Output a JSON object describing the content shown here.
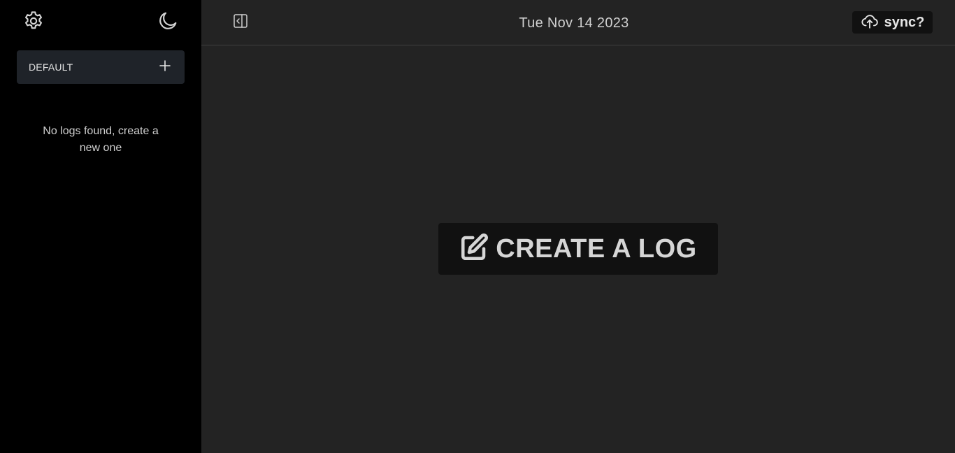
{
  "sidebar": {
    "settings_icon": "gear-icon",
    "theme_icon": "moon-icon",
    "group": {
      "label": "DEFAULT",
      "add_icon": "plus-icon"
    },
    "empty_message": "No logs found, create a new one"
  },
  "header": {
    "toggle_icon": "sidebar-collapse-icon",
    "date": "Tue Nov 14 2023",
    "sync": {
      "icon": "cloud-upload-icon",
      "label": "sync?"
    }
  },
  "main": {
    "create_button": {
      "icon": "edit-icon",
      "label": "CREATE A LOG"
    }
  },
  "colors": {
    "sidebar_bg": "#000000",
    "main_bg": "#232323",
    "card_bg": "#1f2329",
    "button_bg": "#111111",
    "text": "#cfcfcf"
  }
}
